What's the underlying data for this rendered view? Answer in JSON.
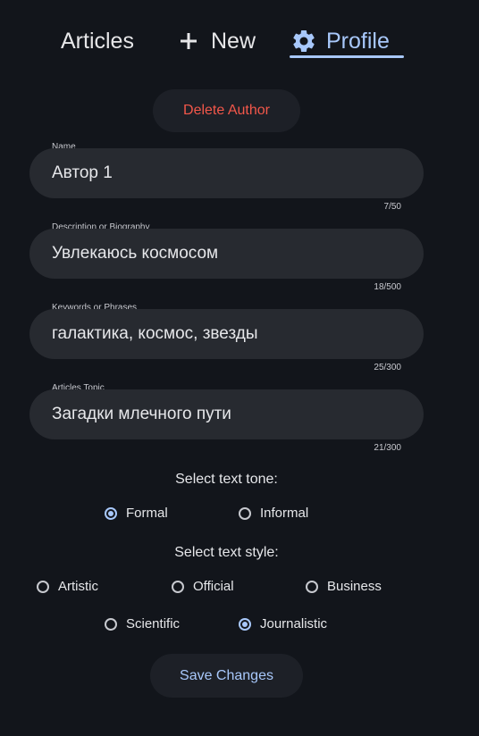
{
  "nav": {
    "articles_label": "Articles",
    "new_label": "New",
    "profile_label": "Profile",
    "new_icon": "plus-icon",
    "profile_icon": "gear-icon",
    "active_tab": "Profile"
  },
  "delete_author_label": "Delete Author",
  "fields": [
    {
      "label": "Name",
      "value": "Автор 1",
      "counter": "7/50"
    },
    {
      "label": "Description or Biography",
      "value": "Увлекаюсь космосом",
      "counter": "18/500"
    },
    {
      "label": "Keywords or Phrases",
      "value": "галактика, космос, звезды",
      "counter": "25/300"
    },
    {
      "label": "Articles Topic",
      "value": "Загадки млечного пути",
      "counter": "21/300"
    }
  ],
  "tone": {
    "title": "Select text tone:",
    "options": [
      "Formal",
      "Informal"
    ],
    "selected": "Formal"
  },
  "style": {
    "title": "Select text style:",
    "options": [
      "Artistic",
      "Official",
      "Business",
      "Scientific",
      "Journalistic"
    ],
    "selected": "Journalistic"
  },
  "save_label": "Save Changes",
  "colors": {
    "background": "#12151b",
    "accent": "#a8c8fb",
    "danger": "#f2574a",
    "field_background": "#272a30"
  }
}
